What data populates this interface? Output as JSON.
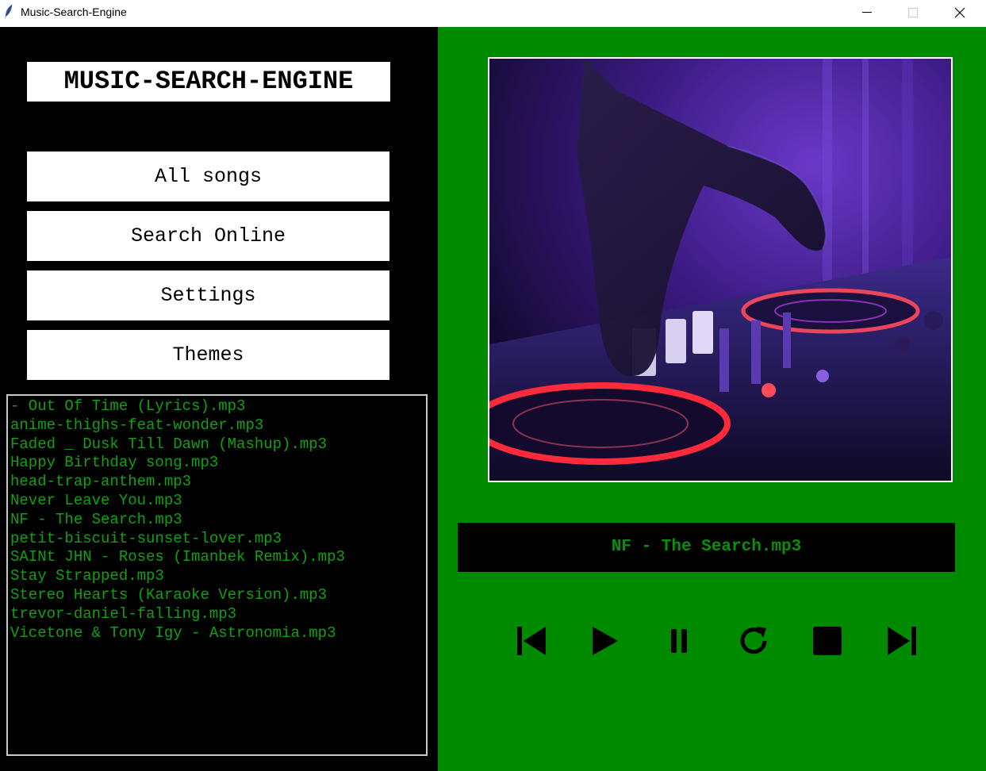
{
  "window": {
    "title": "Music-Search-Engine",
    "icon": "feather-icon"
  },
  "sidebar": {
    "logo": "MUSIC-SEARCH-ENGINE",
    "buttons": [
      "All songs",
      "Search Online",
      "Settings",
      "Themes"
    ]
  },
  "playlist": {
    "songs": [
      "- Out Of Time (Lyrics).mp3",
      "anime-thighs-feat-wonder.mp3",
      "Faded _ Dusk Till Dawn (Mashup).mp3",
      "Happy Birthday song.mp3",
      "head-trap-anthem.mp3",
      "Never Leave You.mp3",
      "NF - The Search.mp3",
      "petit-biscuit-sunset-lover.mp3",
      "SAINt JHN - Roses (Imanbek Remix).mp3",
      "Stay Strapped.mp3",
      "Stereo Hearts (Karaoke Version).mp3",
      "trevor-daniel-falling.mp3",
      "Vicetone & Tony Igy - Astronomia.mp3"
    ]
  },
  "player": {
    "now_playing": "NF - The Search.mp3",
    "controls": [
      "previous-icon",
      "play-icon",
      "pause-icon",
      "repeat-icon",
      "stop-icon",
      "next-icon"
    ]
  },
  "colors": {
    "left_bg": "#000000",
    "right_bg": "#008a00",
    "song_text": "#10a010",
    "now_playing_text": "#0a8f0a"
  }
}
